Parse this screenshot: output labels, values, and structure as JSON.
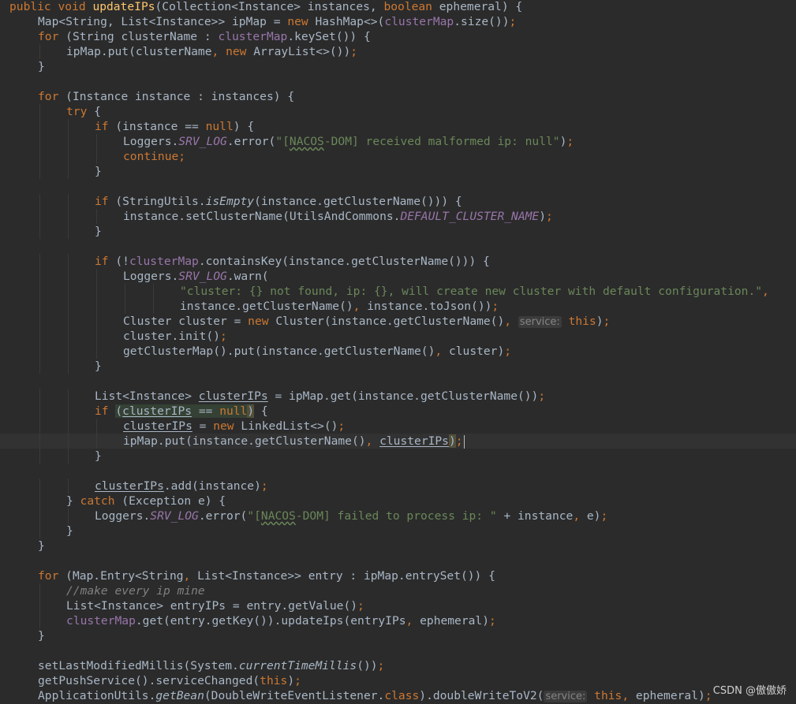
{
  "colors": {
    "background": "#2b2b2b",
    "plain": "#a9b7c6",
    "keyword": "#cc7832",
    "field": "#9876aa",
    "method": "#ffc66d",
    "string": "#6a8759",
    "comment": "#808080",
    "inlay_hint": "#858585"
  },
  "watermark": "CSDN @傲傲娇",
  "code_lines": [
    {
      "indent": 0,
      "tokens": [
        [
          "kw",
          "public void "
        ],
        [
          "method",
          "updateIPs"
        ],
        [
          "plain",
          "(Collection<Instance> instances, "
        ],
        [
          "kw",
          "boolean "
        ],
        [
          "plain",
          "ephemeral) {"
        ]
      ]
    },
    {
      "indent": 1,
      "tokens": [
        [
          "plain",
          "Map<String, List<Instance>> ipMap = "
        ],
        [
          "kw",
          "new "
        ],
        [
          "plain",
          "HashMap<>("
        ],
        [
          "field",
          "clusterMap"
        ],
        [
          "plain",
          ".size())"
        ],
        [
          "kw",
          ";"
        ]
      ]
    },
    {
      "indent": 1,
      "tokens": [
        [
          "kw",
          "for "
        ],
        [
          "plain",
          "(String clusterName : "
        ],
        [
          "field",
          "clusterMap"
        ],
        [
          "plain",
          ".keySet()) {"
        ]
      ]
    },
    {
      "indent": 2,
      "tokens": [
        [
          "plain",
          "ipMap.put(clusterName"
        ],
        [
          "kw",
          ", new "
        ],
        [
          "plain",
          "ArrayList<>())"
        ],
        [
          "kw",
          ";"
        ]
      ]
    },
    {
      "indent": 1,
      "tokens": [
        [
          "plain",
          "}"
        ]
      ]
    },
    {
      "indent": 0,
      "tokens": []
    },
    {
      "indent": 1,
      "tokens": [
        [
          "kw",
          "for "
        ],
        [
          "plain",
          "(Instance instance : instances) {"
        ]
      ]
    },
    {
      "indent": 2,
      "tokens": [
        [
          "kw",
          "try "
        ],
        [
          "plain",
          "{"
        ]
      ]
    },
    {
      "indent": 3,
      "tokens": [
        [
          "kw",
          "if "
        ],
        [
          "plain",
          "(instance == "
        ],
        [
          "kw",
          "null"
        ],
        [
          "plain",
          ") {"
        ]
      ]
    },
    {
      "indent": 4,
      "tokens": [
        [
          "plain",
          "Loggers."
        ],
        [
          "static",
          "SRV_LOG"
        ],
        [
          "plain",
          ".error("
        ],
        [
          "str",
          "\"["
        ],
        [
          "typo",
          "NACOS"
        ],
        [
          "str",
          "-DOM] received malformed ip: null\""
        ],
        [
          "plain",
          ")"
        ],
        [
          "kw",
          ";"
        ]
      ]
    },
    {
      "indent": 4,
      "tokens": [
        [
          "kw",
          "continue;"
        ]
      ]
    },
    {
      "indent": 3,
      "tokens": [
        [
          "plain",
          "}"
        ]
      ]
    },
    {
      "indent": 0,
      "tokens": []
    },
    {
      "indent": 3,
      "tokens": [
        [
          "kw",
          "if "
        ],
        [
          "plain",
          "(StringUtils."
        ],
        [
          "italic",
          "isEmpty"
        ],
        [
          "plain",
          "(instance.getClusterName())) {"
        ]
      ]
    },
    {
      "indent": 4,
      "tokens": [
        [
          "plain",
          "instance.setClusterName(UtilsAndCommons."
        ],
        [
          "static",
          "DEFAULT_CLUSTER_NAME"
        ],
        [
          "plain",
          ")"
        ],
        [
          "kw",
          ";"
        ]
      ]
    },
    {
      "indent": 3,
      "tokens": [
        [
          "plain",
          "}"
        ]
      ]
    },
    {
      "indent": 0,
      "tokens": []
    },
    {
      "indent": 3,
      "tokens": [
        [
          "kw",
          "if "
        ],
        [
          "plain",
          "(!"
        ],
        [
          "field",
          "clusterMap"
        ],
        [
          "plain",
          ".containsKey(instance.getClusterName())) {"
        ]
      ]
    },
    {
      "indent": 4,
      "tokens": [
        [
          "plain",
          "Loggers."
        ],
        [
          "static",
          "SRV_LOG"
        ],
        [
          "plain",
          ".warn("
        ]
      ]
    },
    {
      "indent": 6,
      "tokens": [
        [
          "str",
          "\"cluster: {} not found, ip: {}, will create new cluster with default configuration.\""
        ],
        [
          "kw",
          ","
        ]
      ]
    },
    {
      "indent": 6,
      "tokens": [
        [
          "plain",
          "instance.getClusterName()"
        ],
        [
          "kw",
          ", "
        ],
        [
          "plain",
          "instance.toJson())"
        ],
        [
          "kw",
          ";"
        ]
      ]
    },
    {
      "indent": 4,
      "tokens": [
        [
          "plain",
          "Cluster cluster = "
        ],
        [
          "kw",
          "new "
        ],
        [
          "plain",
          "Cluster(instance.getClusterName()"
        ],
        [
          "kw",
          ", "
        ],
        [
          "hint",
          "service:"
        ],
        [
          "kw",
          " this"
        ],
        [
          "plain",
          ")"
        ],
        [
          "kw",
          ";"
        ]
      ]
    },
    {
      "indent": 4,
      "tokens": [
        [
          "plain",
          "cluster.init()"
        ],
        [
          "kw",
          ";"
        ]
      ]
    },
    {
      "indent": 4,
      "tokens": [
        [
          "plain",
          "getClusterMap().put(instance.getClusterName()"
        ],
        [
          "kw",
          ", "
        ],
        [
          "plain",
          "cluster)"
        ],
        [
          "kw",
          ";"
        ]
      ]
    },
    {
      "indent": 3,
      "tokens": [
        [
          "plain",
          "}"
        ]
      ]
    },
    {
      "indent": 0,
      "tokens": []
    },
    {
      "indent": 3,
      "tokens": [
        [
          "plain",
          "List<Instance> "
        ],
        [
          "under",
          "clusterIPs"
        ],
        [
          "plain",
          " = ipMap.get(instance.getClusterName())"
        ],
        [
          "kw",
          ";"
        ]
      ]
    },
    {
      "indent": 3,
      "tokens": [
        [
          "kw",
          "if "
        ],
        [
          "hl",
          "("
        ],
        [
          "hlu",
          "clusterIPs"
        ],
        [
          "hl",
          " == "
        ],
        [
          "hlkw",
          "null"
        ],
        [
          "hl2",
          ")"
        ],
        [
          "plain",
          " {"
        ]
      ]
    },
    {
      "indent": 4,
      "tokens": [
        [
          "under",
          "clusterIPs"
        ],
        [
          "plain",
          " = "
        ],
        [
          "kw",
          "new "
        ],
        [
          "plain",
          "LinkedList<>()"
        ],
        [
          "kw",
          ";"
        ]
      ]
    },
    {
      "indent": 4,
      "current": true,
      "tokens": [
        [
          "plain",
          "ipMap.put(instance.getClusterName()"
        ],
        [
          "kw",
          ", "
        ],
        [
          "under",
          "clusterIPs"
        ],
        [
          "hl2",
          ")"
        ],
        [
          "kw",
          ";"
        ],
        [
          "caret",
          ""
        ]
      ]
    },
    {
      "indent": 3,
      "tokens": [
        [
          "plain",
          "}"
        ]
      ]
    },
    {
      "indent": 0,
      "tokens": []
    },
    {
      "indent": 3,
      "tokens": [
        [
          "under",
          "clusterIPs"
        ],
        [
          "plain",
          ".add(instance)"
        ],
        [
          "kw",
          ";"
        ]
      ]
    },
    {
      "indent": 2,
      "tokens": [
        [
          "plain",
          "} "
        ],
        [
          "kw",
          "catch "
        ],
        [
          "plain",
          "(Exception e) {"
        ]
      ]
    },
    {
      "indent": 3,
      "tokens": [
        [
          "plain",
          "Loggers."
        ],
        [
          "static",
          "SRV_LOG"
        ],
        [
          "plain",
          ".error("
        ],
        [
          "str",
          "\"["
        ],
        [
          "typo",
          "NACOS"
        ],
        [
          "str",
          "-DOM] failed to process ip: \""
        ],
        [
          "plain",
          " + instance"
        ],
        [
          "kw",
          ", "
        ],
        [
          "plain",
          "e)"
        ],
        [
          "kw",
          ";"
        ]
      ]
    },
    {
      "indent": 2,
      "tokens": [
        [
          "plain",
          "}"
        ]
      ]
    },
    {
      "indent": 1,
      "tokens": [
        [
          "plain",
          "}"
        ]
      ]
    },
    {
      "indent": 0,
      "tokens": []
    },
    {
      "indent": 1,
      "tokens": [
        [
          "kw",
          "for "
        ],
        [
          "plain",
          "(Map.Entry<String"
        ],
        [
          "kw",
          ", "
        ],
        [
          "plain",
          "List<Instance>> entry : ipMap.entrySet()) {"
        ]
      ]
    },
    {
      "indent": 2,
      "tokens": [
        [
          "comment",
          "//make every ip mine"
        ]
      ]
    },
    {
      "indent": 2,
      "tokens": [
        [
          "plain",
          "List<Instance> entryIPs = entry.getValue()"
        ],
        [
          "kw",
          ";"
        ]
      ]
    },
    {
      "indent": 2,
      "tokens": [
        [
          "field",
          "clusterMap"
        ],
        [
          "plain",
          ".get(entry.getKey()).updateIps(entryIPs"
        ],
        [
          "kw",
          ", "
        ],
        [
          "plain",
          "ephemeral)"
        ],
        [
          "kw",
          ";"
        ]
      ]
    },
    {
      "indent": 1,
      "tokens": [
        [
          "plain",
          "}"
        ]
      ]
    },
    {
      "indent": 0,
      "tokens": []
    },
    {
      "indent": 1,
      "tokens": [
        [
          "plain",
          "setLastModifiedMillis(System."
        ],
        [
          "italic",
          "currentTimeMillis"
        ],
        [
          "plain",
          "())"
        ],
        [
          "kw",
          ";"
        ]
      ]
    },
    {
      "indent": 1,
      "tokens": [
        [
          "plain",
          "getPushService().serviceChanged("
        ],
        [
          "kw",
          "this"
        ],
        [
          "plain",
          ")"
        ],
        [
          "kw",
          ";"
        ]
      ]
    },
    {
      "indent": 1,
      "tokens": [
        [
          "plain",
          "ApplicationUtils."
        ],
        [
          "italic",
          "getBean"
        ],
        [
          "plain",
          "(DoubleWriteEventListener."
        ],
        [
          "kw",
          "class"
        ],
        [
          "plain",
          ").doubleWriteToV2("
        ],
        [
          "hint",
          "service:"
        ],
        [
          "kw",
          " this"
        ],
        [
          "kw",
          ", "
        ],
        [
          "plain",
          "ephemeral)"
        ],
        [
          "kw",
          ";"
        ]
      ]
    }
  ]
}
